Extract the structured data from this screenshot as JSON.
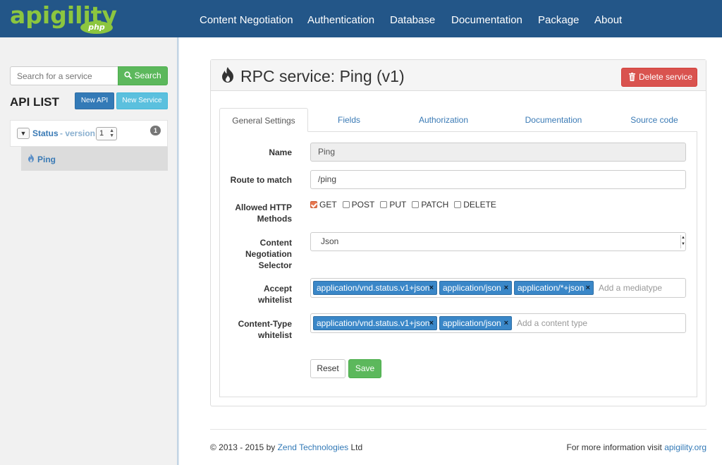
{
  "brand": {
    "logo_text": "apigility",
    "logo_badge": "php",
    "logo_color": "#8cc63f"
  },
  "navbar": {
    "background": "#235688",
    "items": [
      {
        "label": "Content Negotiation"
      },
      {
        "label": "Authentication"
      },
      {
        "label": "Database"
      },
      {
        "label": "Documentation"
      },
      {
        "label": "Package"
      },
      {
        "label": "About"
      }
    ]
  },
  "sidebar": {
    "search": {
      "placeholder": "Search for a service",
      "value": "",
      "button_label": "Search"
    },
    "api_list_title": "API LIST",
    "new_api_label": "New API",
    "new_service_label": "New Service",
    "apis": [
      {
        "toggle_icon": "chevron-down-icon",
        "name": "Status",
        "version_label": "- version",
        "version_selected": "1",
        "service_count": "1",
        "services": [
          {
            "icon": "fire-icon",
            "name": "Ping"
          }
        ]
      }
    ]
  },
  "panel": {
    "title": "RPC service: Ping (v1)",
    "title_icon": "fire-icon",
    "delete_label": "Delete service",
    "delete_icon": "trash-icon",
    "tabs": [
      {
        "label": "General Settings",
        "active": true
      },
      {
        "label": "Fields"
      },
      {
        "label": "Authorization"
      },
      {
        "label": "Documentation"
      },
      {
        "label": "Source code"
      }
    ],
    "form": {
      "name": {
        "label": "Name",
        "value": "Ping"
      },
      "route": {
        "label": "Route to match",
        "value": "/ping"
      },
      "methods": {
        "label_line1": "Allowed HTTP",
        "label_line2": "Methods",
        "options": [
          {
            "label": "GET",
            "checked": true
          },
          {
            "label": "POST",
            "checked": false
          },
          {
            "label": "PUT",
            "checked": false
          },
          {
            "label": "PATCH",
            "checked": false
          },
          {
            "label": "DELETE",
            "checked": false
          }
        ]
      },
      "selector": {
        "label_line1": "Content",
        "label_line2": "Negotiation",
        "label_line3": "Selector",
        "value": "Json"
      },
      "accept": {
        "label_line1": "Accept",
        "label_line2": "whitelist",
        "tags": [
          "application/vnd.status.v1+json",
          "application/json",
          "application/*+json"
        ],
        "placeholder": "Add a mediatype"
      },
      "content_type": {
        "label_line1": "Content-Type",
        "label_line2": "whitelist",
        "tags": [
          "application/vnd.status.v1+json",
          "application/json"
        ],
        "placeholder": "Add a content type"
      },
      "reset_label": "Reset",
      "save_label": "Save",
      "tag_remove_glyph": "×"
    }
  },
  "footer": {
    "copyright_prefix": "© 2013 - 2015 by",
    "company_link": "Zend Technologies",
    "company_suffix": "Ltd",
    "info_prefix": "For more information visit",
    "site_link": "apigility.org"
  }
}
